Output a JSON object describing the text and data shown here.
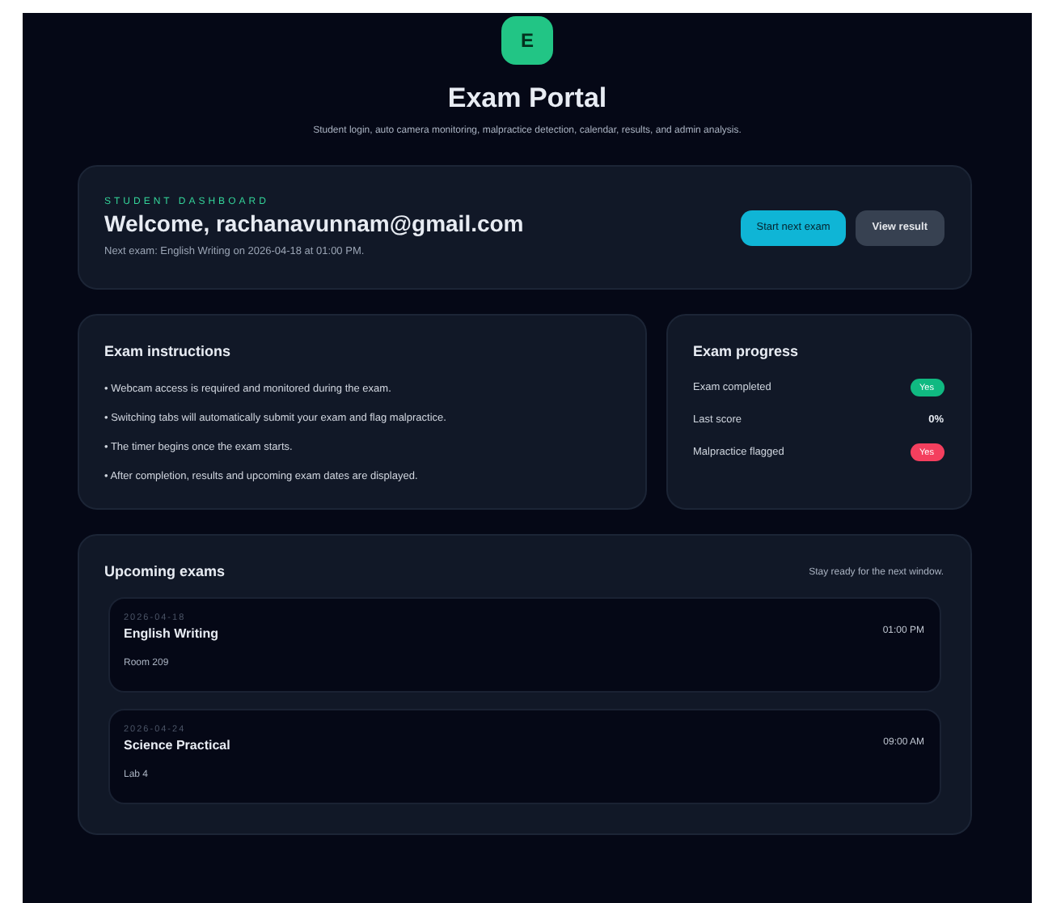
{
  "logo": {
    "letter": "E"
  },
  "title": "Exam Portal",
  "subtitle": "Student login, auto camera monitoring, malpractice detection, calendar, results, and admin analysis.",
  "dashboard": {
    "eyebrow": "STUDENT DASHBOARD",
    "welcome": "Welcome, rachanavunnam@gmail.com",
    "next_exam": "Next exam: English Writing on 2026-04-18 at 01:00 PM.",
    "buttons": [
      {
        "label": "Start next exam",
        "kind": "primary"
      },
      {
        "label": "View result",
        "kind": "secondary"
      }
    ]
  },
  "instructions": {
    "title": "Exam instructions",
    "items": [
      "• Webcam access is required and monitored during the exam.",
      "• Switching tabs will automatically submit your exam and flag malpractice.",
      "• The timer begins once the exam starts.",
      "• After completion, results and upcoming exam dates are displayed."
    ]
  },
  "progress": {
    "title": "Exam progress",
    "rows": [
      {
        "label": "Exam completed",
        "kind": "badge",
        "value": "Yes",
        "color": "#10b981"
      },
      {
        "label": "Last score",
        "kind": "text",
        "value": "0%"
      },
      {
        "label": "Malpractice flagged",
        "kind": "badge",
        "value": "Yes",
        "color": "#f43f5e"
      }
    ]
  },
  "upcoming": {
    "title": "Upcoming exams",
    "note": "Stay ready for the next window.",
    "exams": [
      {
        "date": "2026-04-18",
        "name": "English Writing",
        "place": "Room 209",
        "time": "01:00 PM"
      },
      {
        "date": "2026-04-24",
        "name": "Science Practical",
        "place": "Lab 4",
        "time": "09:00 AM"
      }
    ]
  }
}
